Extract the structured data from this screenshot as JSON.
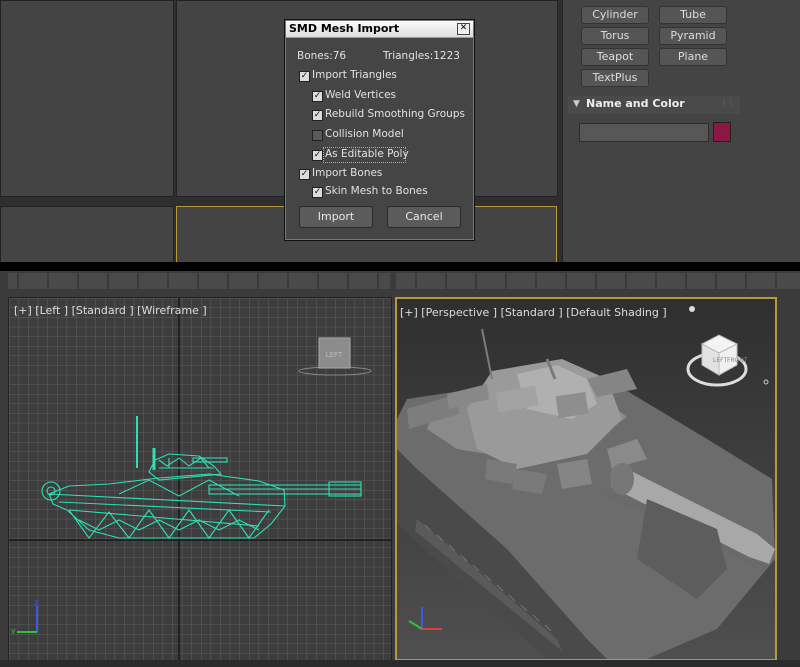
{
  "command_panel": {
    "object_buttons": [
      "Cylinder",
      "Tube",
      "Torus",
      "Pyramid",
      "Teapot",
      "Plane",
      "TextPlus"
    ],
    "rollout_title": "Name and Color",
    "object_name": "",
    "object_color": "#8b1746"
  },
  "dialog": {
    "title": "SMD Mesh Import",
    "bones_label": "Bones:76",
    "triangles_label": "Triangles:1223",
    "options": [
      {
        "label": "Import Triangles",
        "checked": true
      },
      {
        "label": "Weld Vertices",
        "checked": true
      },
      {
        "label": "Rebuild Smoothing Groups",
        "checked": true
      },
      {
        "label": "Collision Model",
        "checked": false
      },
      {
        "label": "As Editable Poly",
        "checked": true
      },
      {
        "label": "Import Bones",
        "checked": true
      },
      {
        "label": "Skin Mesh to Bones",
        "checked": true
      }
    ],
    "import_label": "Import",
    "cancel_label": "Cancel"
  },
  "viewports": {
    "left": {
      "title": "[+] [Left ] [Standard ] [Wireframe ]",
      "viewcube_face": "LEFT"
    },
    "perspective": {
      "title": "[+] [Perspective ] [Standard ] [Default Shading ]",
      "viewcube_faces": [
        "TOP",
        "FRONT",
        "LEFT"
      ]
    }
  },
  "colors": {
    "wireframe": "#2ee0b5",
    "active_border": "#b59a3c"
  }
}
